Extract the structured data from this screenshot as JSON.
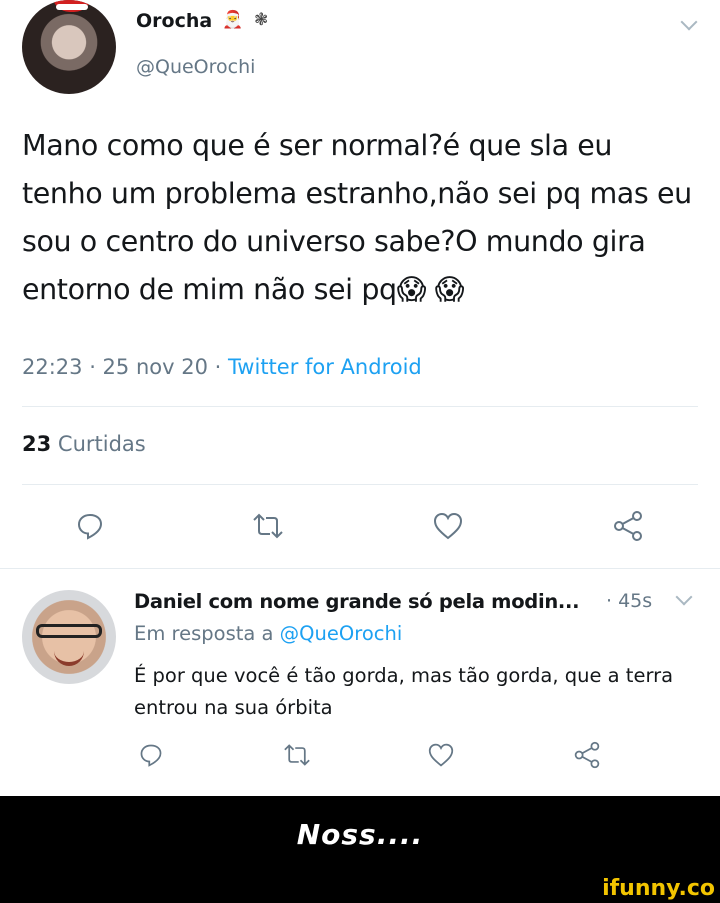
{
  "tweet": {
    "author_name": "Orocha",
    "author_emoji": "🎅",
    "author_symbol": "❃",
    "handle": "@QueOrochi",
    "text": "Mano como que é ser normal?é que sla eu tenho um problema estranho,não sei pq mas eu sou o centro do universo sabe?O mundo gira entorno de mim não sei pq😱 😱",
    "time": "22:23 · 25 nov 20 · ",
    "source": "Twitter for Android",
    "likes_count": "23",
    "likes_label": "Curtidas"
  },
  "reply": {
    "author_name": "Daniel com nome grande só pela modin...",
    "time": "· 45s",
    "reply_to_prefix": "Em resposta a ",
    "reply_to_handle": "@QueOrochi",
    "text": "É por que você é tão gorda, mas tão gorda, que a terra entrou na sua órbita"
  },
  "caption": "Noss....",
  "watermark": "ifunny.co",
  "icons": [
    "reply-icon",
    "retweet-icon",
    "like-icon",
    "share-icon",
    "chevron-down-icon"
  ],
  "colors": {
    "link": "#1da1f2",
    "secondary_text": "#657786",
    "caption_band": "#000000",
    "watermark": "#f2c400"
  }
}
